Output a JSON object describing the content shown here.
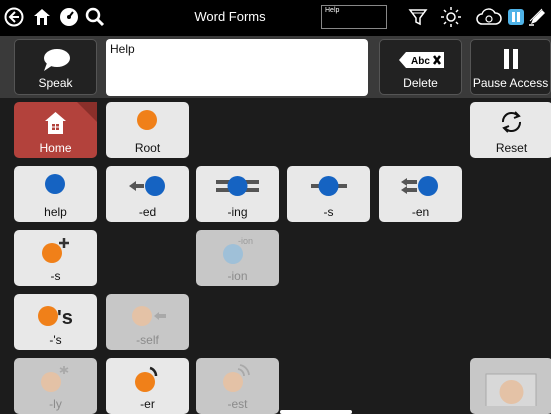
{
  "topbar": {
    "title": "Word Forms",
    "search_value": "Help",
    "icons": [
      "back-icon",
      "home-icon",
      "gauge-icon",
      "search-icon",
      "filter-icon",
      "brightness-icon",
      "cloud-sync-icon",
      "pause-icon",
      "edit-icon"
    ]
  },
  "message": {
    "speak_label": "Speak",
    "text": "Help",
    "delete_label": "Delete",
    "delete_key_text": "Abc",
    "pause_label": "Pause Access"
  },
  "grid": {
    "home": "Home",
    "root": "Root",
    "reset": "Reset",
    "row1": [
      "help",
      "-ed",
      "-ing",
      "-s",
      "-en"
    ],
    "row2": [
      "-s",
      "-ion"
    ],
    "row2_ion_glyph": "-ion",
    "row3": [
      "-'s",
      "-self"
    ],
    "row3_s_glyph": "'s",
    "row4": [
      "-ly",
      "-er",
      "-est"
    ]
  },
  "colors": {
    "home_bg": "#b3423c",
    "blue_dot": "#1563c2",
    "orange_dot": "#f08019"
  }
}
